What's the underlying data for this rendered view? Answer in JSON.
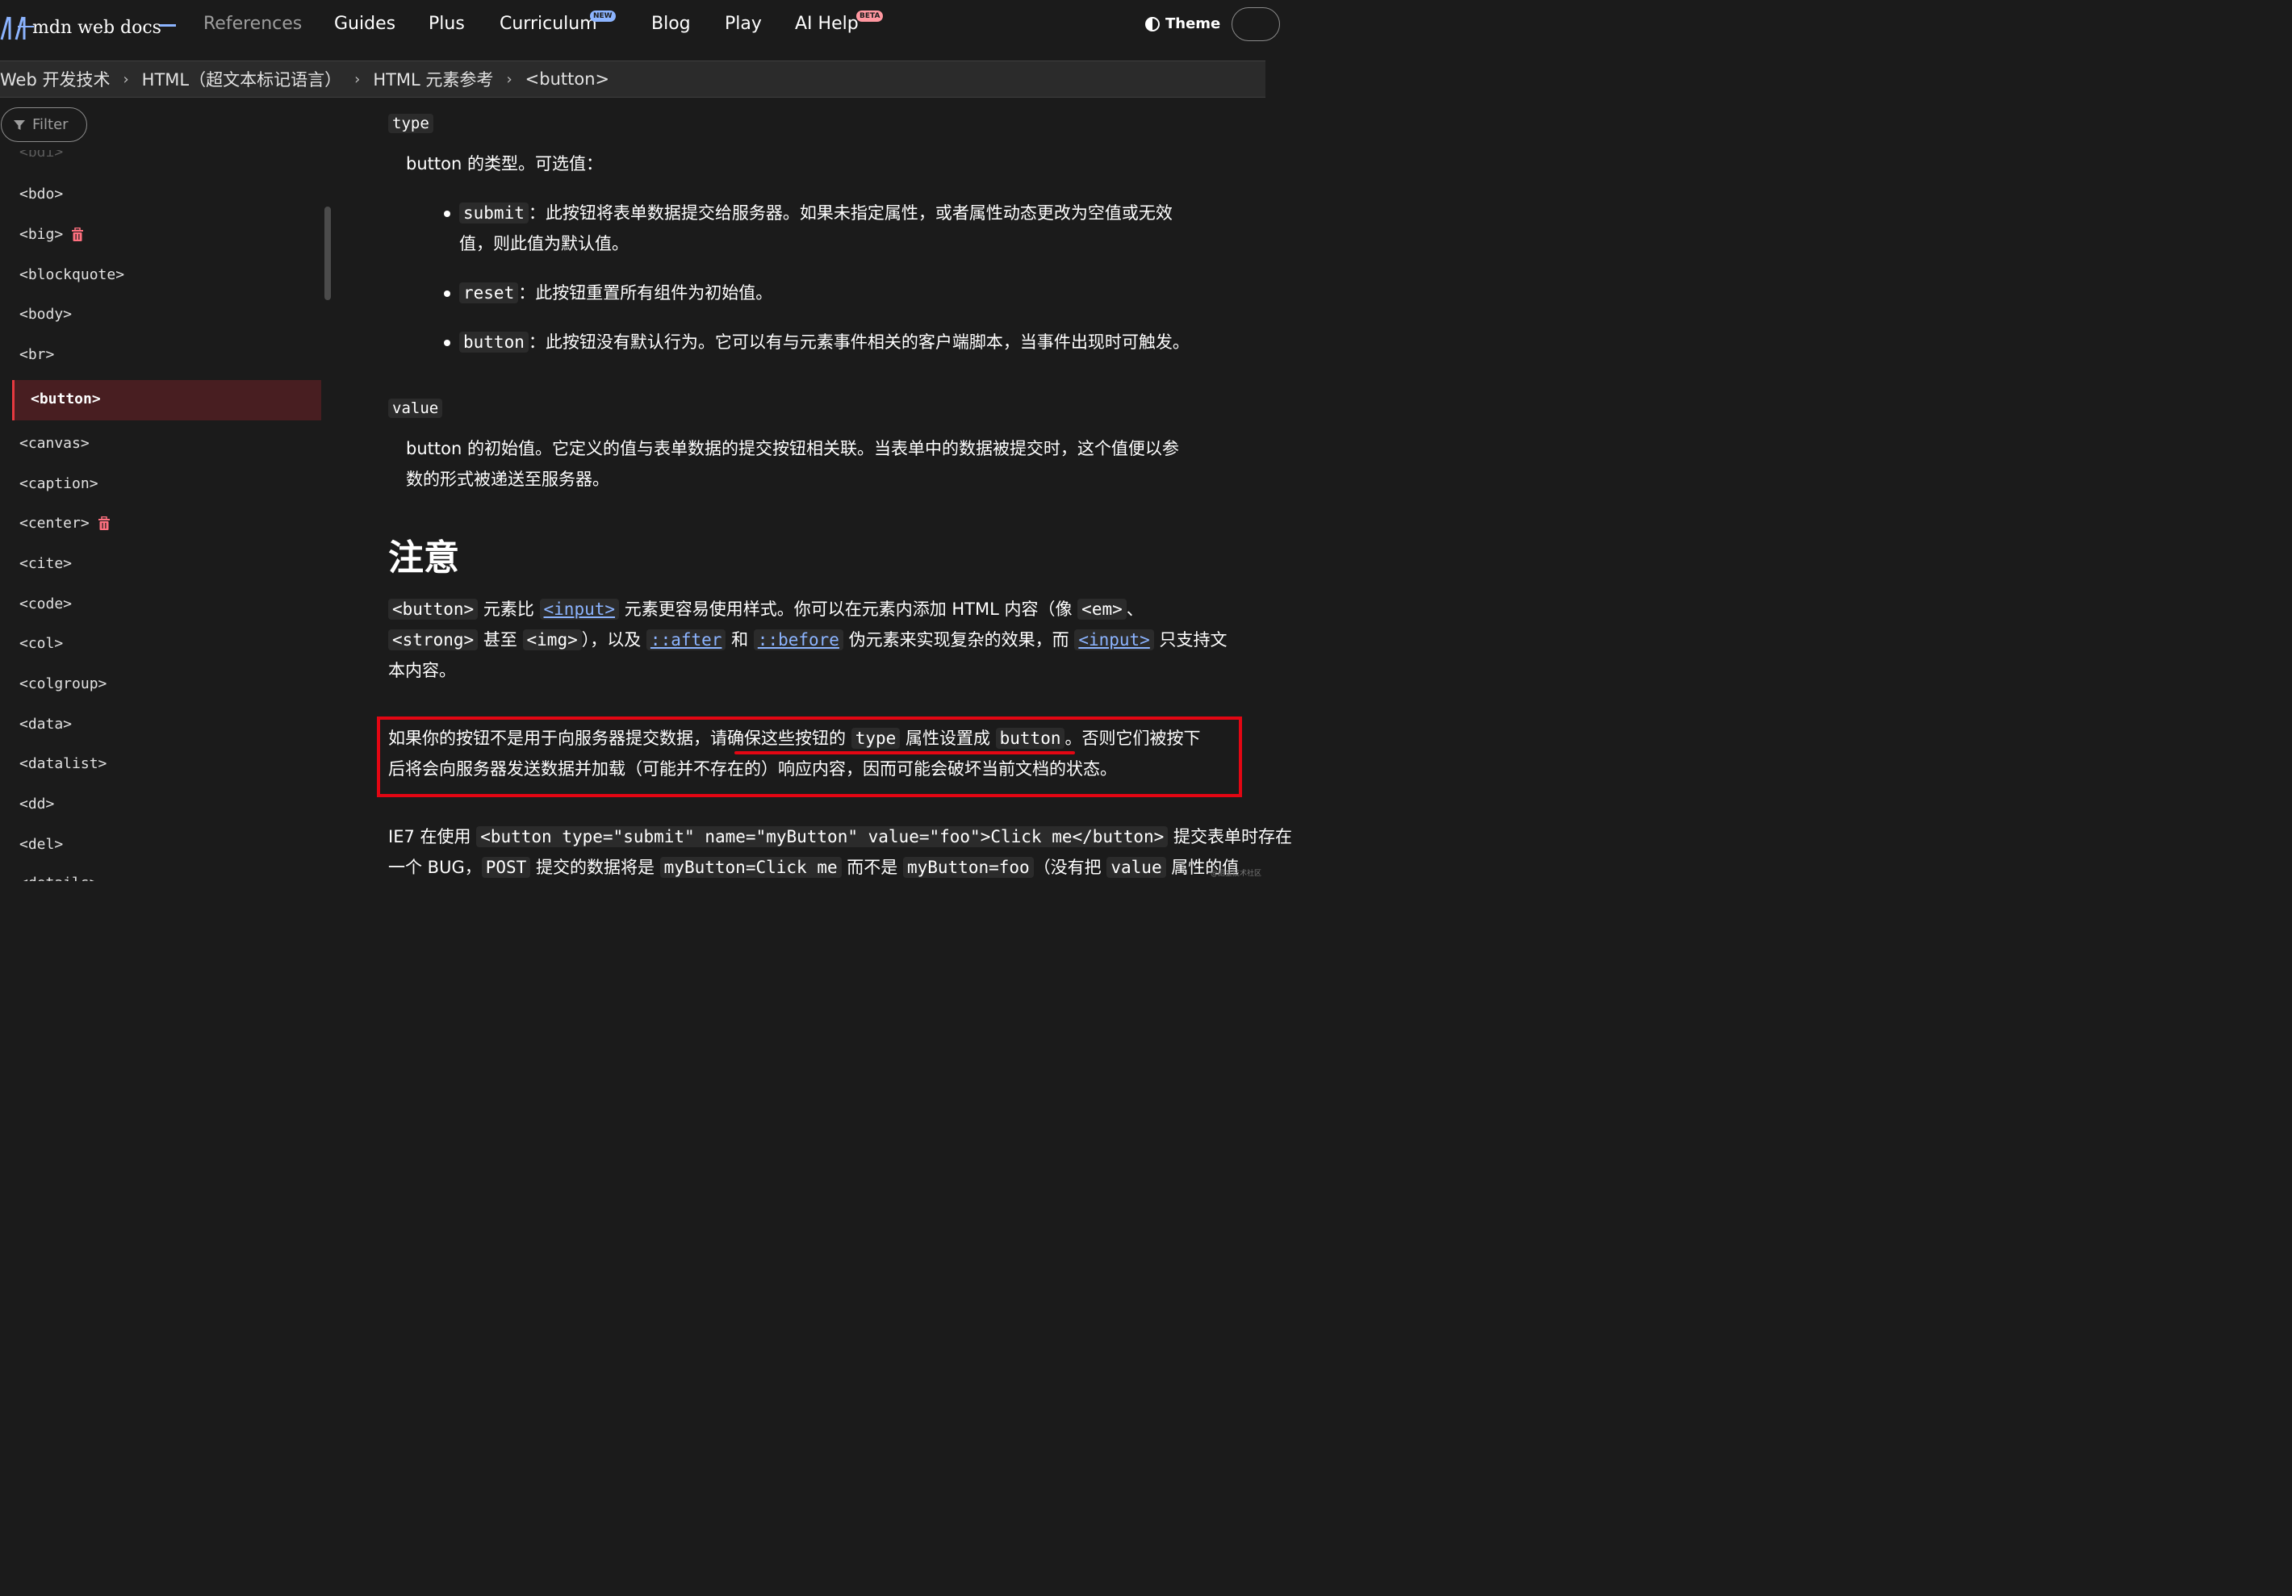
{
  "header": {
    "logo_text": "mdn web docs",
    "nav": [
      "References",
      "Guides",
      "Plus",
      "Curriculum",
      "Blog",
      "Play",
      "AI Help"
    ],
    "badge_new": "NEW",
    "badge_beta": "BETA",
    "theme_label": "Theme"
  },
  "breadcrumb": [
    "Web 开发技术",
    "HTML（超文本标记语言）",
    "HTML 元素参考",
    "<button>"
  ],
  "sidebar": {
    "filter_label": "Filter",
    "items": [
      "<bdi>",
      "<bdo>",
      "<big>",
      "<blockquote>",
      "<body>",
      "<br>",
      "<button>",
      "<canvas>",
      "<caption>",
      "<center>",
      "<cite>",
      "<code>",
      "<col>",
      "<colgroup>",
      "<data>",
      "<datalist>",
      "<dd>",
      "<del>",
      "<details>"
    ],
    "active_item": "<button>"
  },
  "main": {
    "type_term": "type",
    "type_desc": "button 的类型。可选值：",
    "submit_code": "submit",
    "submit_text_1": "：此按钮将表单数据提交给服务器。如果未指定属性，或者属性动态更改为空值或无效",
    "submit_text_2": "值，则此值为默认值。",
    "reset_code": "reset",
    "reset_text": "：此按钮重置所有组件为初始值。",
    "button_code": "button",
    "button_text": "：此按钮没有默认行为。它可以有与元素事件相关的客户端脚本，当事件出现时可触发。",
    "value_term": "value",
    "value_desc_1": "button 的初始值。它定义的值与表单数据的提交按钮相关联。当表单中的数据被提交时，这个值便以参",
    "value_desc_2": "数的形式被递送至服务器。",
    "notes_heading": "注意",
    "p1": {
      "c1": "<button>",
      "t1": " 元素比 ",
      "l1": "<input>",
      "t2": " 元素更容易使用样式。你可以在元素内添加 HTML 内容（像 ",
      "c2": "<em>",
      "t3": "、",
      "c3": "<strong>",
      "t4": " 甚至 ",
      "c4": "<img>",
      "t5": "），以及 ",
      "l2": "::after",
      "t6": " 和 ",
      "l3": "::before",
      "t7": " 伪元素来实现复杂的效果，而 ",
      "l4": "<input>",
      "t8": " 只支持文",
      "t9": "本内容。"
    },
    "p2": {
      "t1": "如果你的按钮不是用于向服务器提交数据，请确保这些按钮的 ",
      "c1": "type",
      "t2": " 属性设置成 ",
      "c2": "button",
      "t3": "。否则它们被按下",
      "t4": "后将会向服务器发送数据并加载（可能并不存在的）响应内容，因而可能会破坏当前文档的状态。"
    },
    "p3": {
      "t1": "IE7 在使用 ",
      "c1": "<button type=\"submit\" name=\"myButton\" value=\"foo\">Click me</button>",
      "t2": " 提交表单时存在",
      "t3": "一个 BUG，",
      "c2": "POST",
      "t4": " 提交的数据将是 ",
      "c3": "myButton=Click me",
      "t5": " 而不是 ",
      "c4": "myButton=foo",
      "t6": "（没有把 ",
      "c5": "value",
      "t7": " 属性的值"
    }
  },
  "watermark": "@掘金技术社区",
  "colors": {
    "accent": "#8cb4ff",
    "active_bg": "#481e21",
    "active_border": "#e7393f",
    "highlight": "#e30613"
  }
}
